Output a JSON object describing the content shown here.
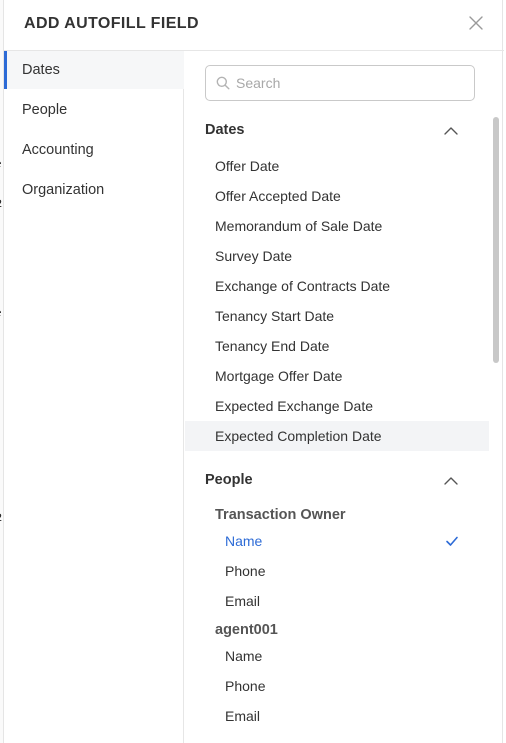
{
  "dialog": {
    "title": "ADD AUTOFILL FIELD",
    "close_icon": "close-icon"
  },
  "sidebar": {
    "items": [
      {
        "label": "Dates",
        "active": true
      },
      {
        "label": "People",
        "active": false
      },
      {
        "label": "Accounting",
        "active": false
      },
      {
        "label": "Organization",
        "active": false
      }
    ]
  },
  "search": {
    "placeholder": "Search",
    "value": "",
    "icon": "search-icon"
  },
  "sections": {
    "dates": {
      "title": "Dates",
      "expanded": true,
      "items": [
        "Offer Date",
        "Offer Accepted Date",
        "Memorandum of Sale Date",
        "Survey Date",
        "Exchange of Contracts Date",
        "Tenancy Start Date",
        "Tenancy End Date",
        "Mortgage Offer Date",
        "Expected Exchange Date",
        "Expected Completion Date"
      ],
      "hovered_item": "Expected Completion Date"
    },
    "people": {
      "title": "People",
      "expanded": true,
      "groups": [
        {
          "label": "Transaction Owner",
          "items": [
            "Name",
            "Phone",
            "Email"
          ],
          "selected_item": "Name"
        },
        {
          "label": "agent001",
          "items": [
            "Name",
            "Phone",
            "Email"
          ]
        }
      ]
    }
  },
  "colors": {
    "accent": "#2d6bd6",
    "sidebar_active_bg": "#f6f7f8",
    "hover_bg": "#f3f4f6",
    "border": "#e6e6e6"
  }
}
